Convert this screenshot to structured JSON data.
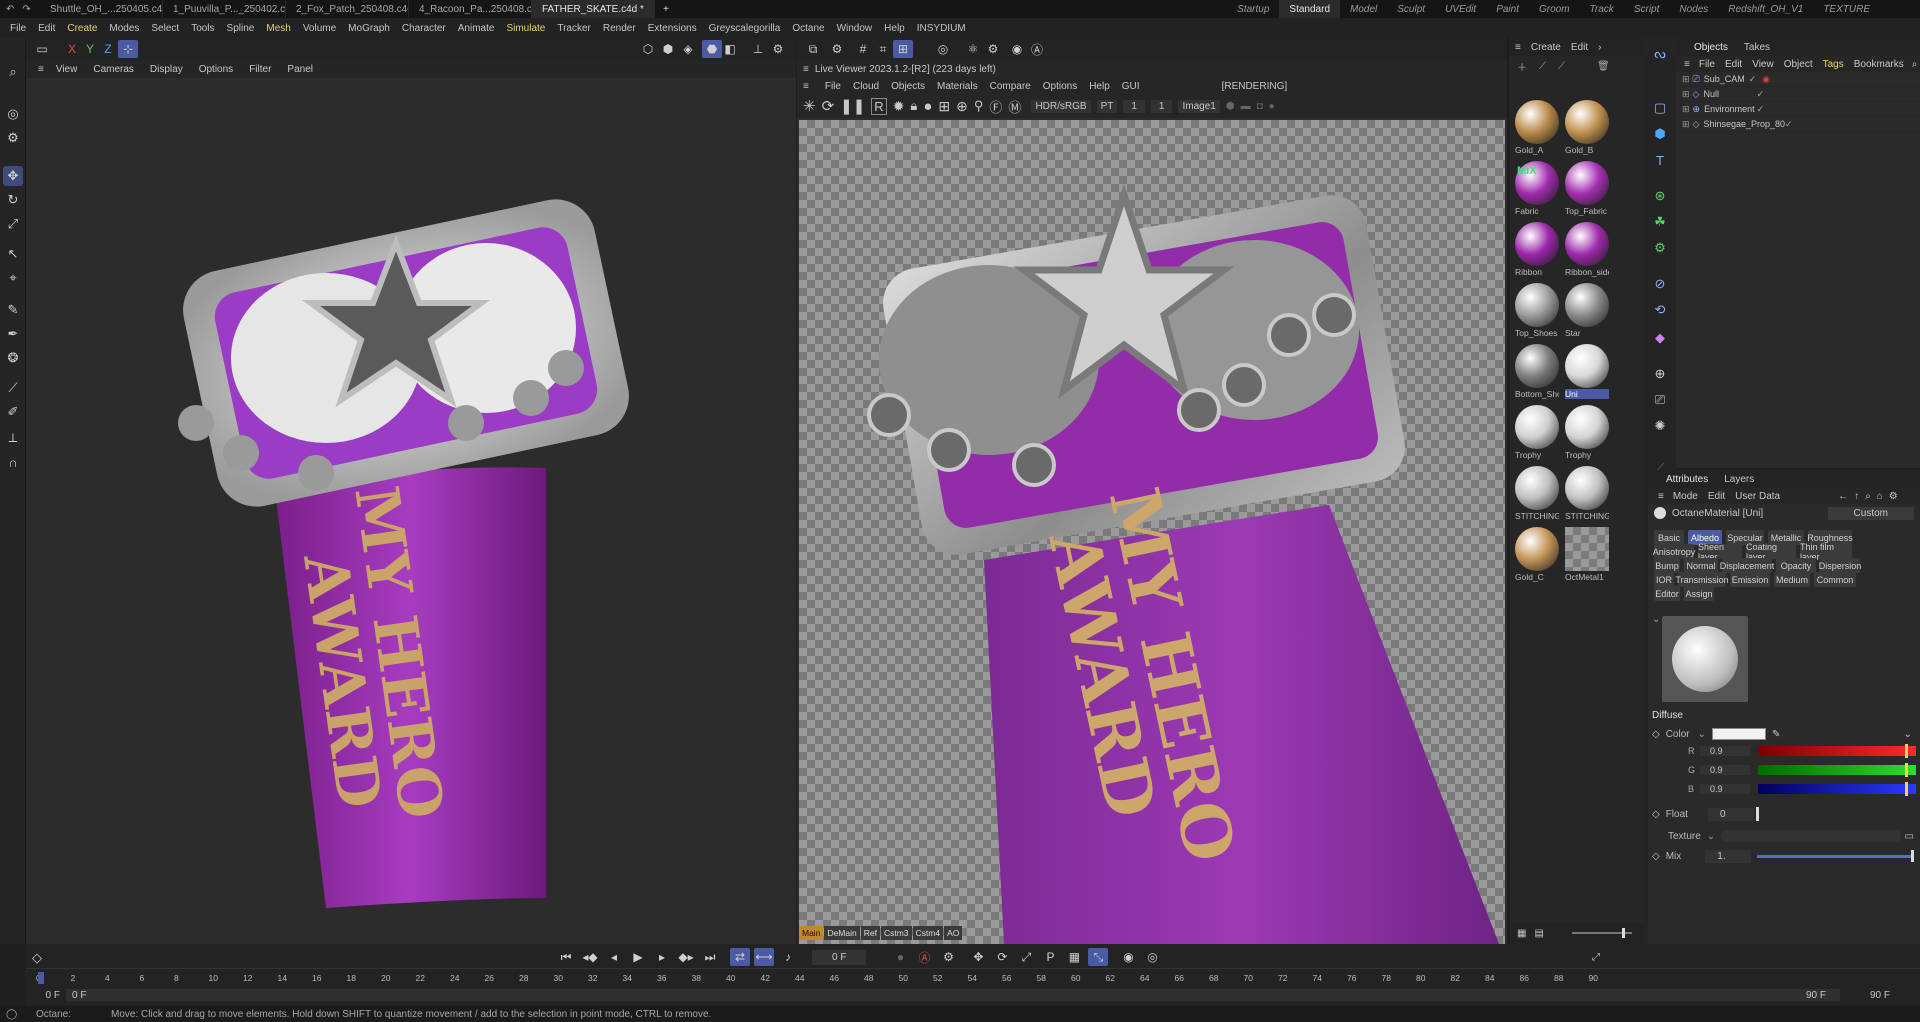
{
  "doc_tabs": [
    {
      "label": "Shuttle_OH_...250405.c4d *",
      "active": false
    },
    {
      "label": "1_Puuvilla_P..._250402.c4d *",
      "active": false
    },
    {
      "label": "2_Fox_Patch_250408.c4d *",
      "active": false
    },
    {
      "label": "4_Racoon_Pa...250408.c4d *",
      "active": false
    },
    {
      "label": "FATHER_SKATE.c4d *",
      "active": true
    }
  ],
  "add_tab": "+",
  "layouts": [
    "Startup",
    "Standard",
    "Model",
    "Sculpt",
    "UVEdit",
    "Paint",
    "Groom",
    "Track",
    "Script",
    "Nodes",
    "Redshift_OH_V1",
    "TEXTURE"
  ],
  "main_menu": [
    "File",
    "Edit",
    "Create",
    "Modes",
    "Select",
    "Tools",
    "Spline",
    "Mesh",
    "Volume",
    "MoGraph",
    "Character",
    "Animate",
    "Simulate",
    "Tracker",
    "Render",
    "Extensions",
    "Greyscalegorilla",
    "Octane",
    "Window",
    "Help",
    "INSYDIUM"
  ],
  "axis": {
    "x": "X",
    "y": "Y",
    "z": "Z"
  },
  "viewport": {
    "menu": [
      "View",
      "Cameras",
      "Display",
      "Options",
      "Filter",
      "Panel"
    ],
    "medal_text": [
      "MY HERO",
      "AWARD"
    ]
  },
  "live_viewer": {
    "title": "Live Viewer 2023.1.2-[R2] (223 days left)",
    "menu": [
      "File",
      "Cloud",
      "Objects",
      "Materials",
      "Compare",
      "Options",
      "Help",
      "GUI"
    ],
    "status": "[RENDERING]",
    "color_space": "HDR/sRGB",
    "kernel": "PT",
    "val1": "1",
    "val2": "1",
    "image": "Image1",
    "bottom_tabs": [
      "Main",
      "DeMain",
      "Ref",
      "Cstm3",
      "Cstm4",
      "AO"
    ],
    "render_text": [
      "MY HERO",
      "AWARD"
    ]
  },
  "material_manager": {
    "menu": [
      "Create",
      "Edit"
    ],
    "materials": [
      {
        "name": "Gold_A",
        "color": "#b98a4a"
      },
      {
        "name": "Gold_B",
        "color": "#c09250"
      },
      {
        "name": "Fabric",
        "color": "#a12cae",
        "mix": "MIX"
      },
      {
        "name": "Top_Fabric",
        "color": "#a530b3"
      },
      {
        "name": "Ribbon",
        "color": "#9a26a8"
      },
      {
        "name": "Ribbon_side",
        "color": "#9d2aaa"
      },
      {
        "name": "Top_Shoes",
        "color": "#9c9c9c"
      },
      {
        "name": "Star",
        "color": "#8a8a8a"
      },
      {
        "name": "Bottom_Shoes",
        "color": "#7d7d7d"
      },
      {
        "name": "Uni",
        "color": "#d8d8d8"
      },
      {
        "name": "Trophy",
        "color": "#cfcfcf"
      },
      {
        "name": "Trophy",
        "color": "#d4d4d4"
      },
      {
        "name": "STITCHING",
        "color": "#bfbfbf"
      },
      {
        "name": "STITCHING",
        "color": "#c3c3c3"
      },
      {
        "name": "Gold_C",
        "color": "#c49558"
      },
      {
        "name": "OctMetal1",
        "color": "checker"
      }
    ]
  },
  "objects_panel": {
    "tabs": [
      "Objects",
      "Takes"
    ],
    "menu": [
      "File",
      "Edit",
      "View",
      "Object",
      "Tags",
      "Bookmarks"
    ],
    "items": [
      "Sub_CAM",
      "Null",
      "Environment",
      "Shinsegae_Prop_80"
    ]
  },
  "attributes": {
    "tabs": [
      "Attributes",
      "Layers"
    ],
    "menu": [
      "Mode",
      "Edit",
      "User Data"
    ],
    "object": "OctaneMaterial [Uni]",
    "preset": "Custom",
    "channels": [
      "Basic",
      "Albedo",
      "Specular",
      "Metallic",
      "Roughness",
      "Anisotropy",
      "Sheen layer",
      "Coating layer",
      "Thin film layer",
      "Bump",
      "Normal",
      "Displacement",
      "Opacity",
      "Dispersion",
      "IOR",
      "Transmission",
      "Emission",
      "Medium",
      "Common",
      "Editor",
      "Assign"
    ],
    "active_channel": "Albedo",
    "section": "Diffuse",
    "color_label": "Color",
    "r_label": "R",
    "g_label": "G",
    "b_label": "B",
    "r": "0.9",
    "g": "0.9",
    "b": "0.9",
    "float_label": "Float",
    "float": "0",
    "texture_label": "Texture",
    "mix_label": "Mix",
    "mix": "1.",
    "swatch": "#f2f2f2"
  },
  "timeline": {
    "frame": "0 F",
    "start": "0 F",
    "start2": "0 F",
    "end": "90 F",
    "end2": "90 F",
    "ticks": [
      "0",
      "2",
      "4",
      "6",
      "8",
      "10",
      "12",
      "14",
      "16",
      "18",
      "20",
      "22",
      "24",
      "26",
      "28",
      "30",
      "32",
      "34",
      "36",
      "38",
      "40",
      "42",
      "44",
      "46",
      "48",
      "50",
      "52",
      "54",
      "56",
      "58",
      "60",
      "62",
      "64",
      "66",
      "68",
      "70",
      "72",
      "74",
      "76",
      "78",
      "80",
      "82",
      "84",
      "86",
      "88",
      "90"
    ]
  },
  "status": {
    "label": "Octane:",
    "message": "Move: Click and drag to move elements. Hold down SHIFT to quantize movement / add to the selection in point mode, CTRL to remove."
  }
}
